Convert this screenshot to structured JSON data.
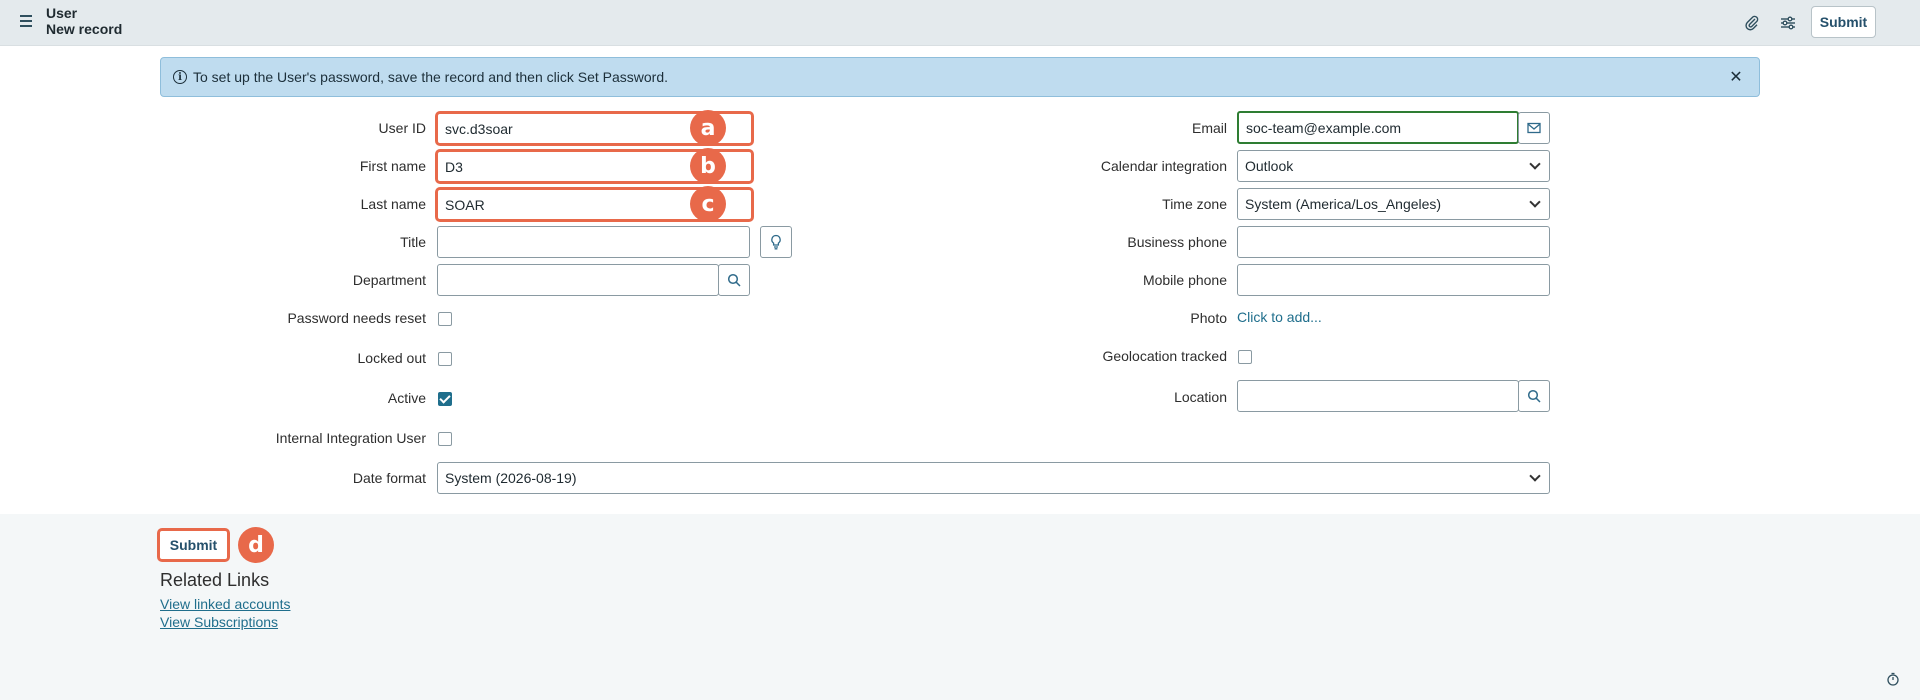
{
  "header": {
    "title_line1": "User",
    "title_line2": "New record",
    "submit_label": "Submit",
    "icons": [
      "menu-icon",
      "paperclip-icon",
      "sliders-icon",
      "more-icon"
    ]
  },
  "banner": {
    "message": "To set up the User's password, save the record and then click Set Password."
  },
  "left_fields": {
    "user_id": {
      "label": "User ID",
      "value": "svc.d3soar"
    },
    "first_name": {
      "label": "First name",
      "value": "D3"
    },
    "last_name": {
      "label": "Last name",
      "value": "SOAR"
    },
    "title": {
      "label": "Title",
      "value": ""
    },
    "department": {
      "label": "Department",
      "value": ""
    },
    "password_needs_reset": {
      "label": "Password needs reset",
      "checked": false
    },
    "locked_out": {
      "label": "Locked out",
      "checked": false
    },
    "active": {
      "label": "Active",
      "checked": true
    },
    "internal_integration_user": {
      "label": "Internal Integration User",
      "checked": false
    },
    "date_format": {
      "label": "Date format",
      "value": "System (2026-08-19)"
    }
  },
  "right_fields": {
    "email": {
      "label": "Email",
      "value": "soc-team@example.com"
    },
    "calendar_integration": {
      "label": "Calendar integration",
      "value": "Outlook"
    },
    "time_zone": {
      "label": "Time zone",
      "value": "System (America/Los_Angeles)"
    },
    "business_phone": {
      "label": "Business phone",
      "value": ""
    },
    "mobile_phone": {
      "label": "Mobile phone",
      "value": ""
    },
    "photo": {
      "label": "Photo",
      "link": "Click to add..."
    },
    "geolocation_tracked": {
      "label": "Geolocation tracked",
      "checked": false
    },
    "location": {
      "label": "Location",
      "value": ""
    }
  },
  "annotations": {
    "a": "a",
    "b": "b",
    "c": "c",
    "d": "d"
  },
  "footer": {
    "submit_label": "Submit",
    "related_links_title": "Related Links",
    "links": [
      "View linked accounts",
      "View Subscriptions"
    ]
  },
  "colors": {
    "accent": "#1f6e8c",
    "annotation": "#e8694a",
    "banner_bg": "#bfdcef",
    "header_bg": "#e4eaed"
  }
}
